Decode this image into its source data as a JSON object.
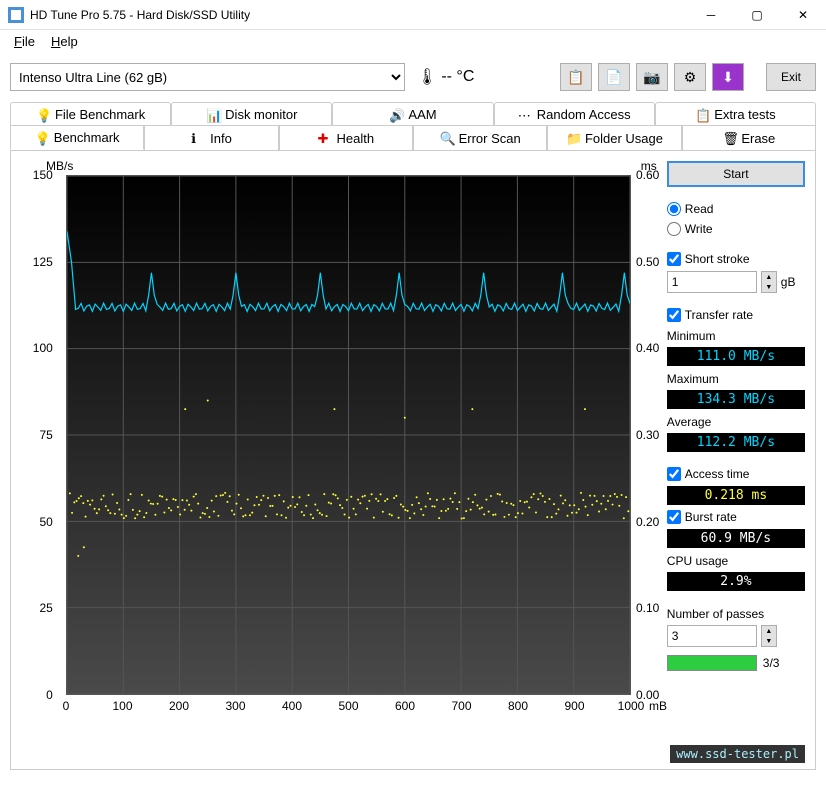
{
  "window": {
    "title": "HD Tune Pro 5.75 - Hard Disk/SSD Utility"
  },
  "menu": {
    "file": "File",
    "help": "Help"
  },
  "toolbar": {
    "drive": "Intenso Ultra Line (62 gB)",
    "temp": "-- °C",
    "exit": "Exit"
  },
  "tabs": {
    "top": [
      "File Benchmark",
      "Disk monitor",
      "AAM",
      "Random Access",
      "Extra tests"
    ],
    "bottom": [
      "Benchmark",
      "Info",
      "Health",
      "Error Scan",
      "Folder Usage",
      "Erase"
    ],
    "active": "Benchmark"
  },
  "side": {
    "start": "Start",
    "read": "Read",
    "write": "Write",
    "short_stroke": "Short stroke",
    "short_stroke_val": "1",
    "short_stroke_unit": "gB",
    "transfer_rate": "Transfer rate",
    "minimum": "Minimum",
    "minimum_val": "111.0 MB/s",
    "maximum": "Maximum",
    "maximum_val": "134.3 MB/s",
    "average": "Average",
    "average_val": "112.2 MB/s",
    "access_time": "Access time",
    "access_time_val": "0.218 ms",
    "burst_rate": "Burst rate",
    "burst_rate_val": "60.9 MB/s",
    "cpu_usage": "CPU usage",
    "cpu_usage_val": "2.9%",
    "passes": "Number of passes",
    "passes_val": "3",
    "passes_done": "3/3"
  },
  "chart_data": {
    "type": "line",
    "y_left_label": "MB/s",
    "y_right_label": "ms",
    "x_label": "mB",
    "y_left_ticks": [
      0,
      25,
      50,
      75,
      100,
      125,
      150
    ],
    "y_right_ticks": [
      0,
      0.1,
      0.2,
      0.3,
      0.4,
      0.5,
      0.6
    ],
    "x_ticks": [
      0,
      100,
      200,
      300,
      400,
      500,
      600,
      700,
      800,
      900,
      1000
    ],
    "xlim": [
      0,
      1000
    ],
    "ylim_left": [
      0,
      150
    ],
    "ylim_right": [
      0,
      0.6
    ],
    "series": [
      {
        "name": "transfer_rate_MBs",
        "axis": "left",
        "color": "#00d6ff",
        "baseline": 112,
        "spikes_at_x": [
          0,
          150,
          300,
          450,
          590,
          740,
          880,
          990
        ],
        "spike_peak": 122,
        "initial_peak": 134
      },
      {
        "name": "access_time_ms",
        "axis": "right",
        "color": "#ffff32",
        "mean": 0.218,
        "spread": 0.015,
        "outliers_low": [
          {
            "x": 20,
            "y": 0.16
          },
          {
            "x": 30,
            "y": 0.17
          }
        ],
        "outliers_high": [
          {
            "x": 210,
            "y": 0.33
          },
          {
            "x": 250,
            "y": 0.34
          },
          {
            "x": 475,
            "y": 0.33
          },
          {
            "x": 600,
            "y": 0.32
          },
          {
            "x": 720,
            "y": 0.33
          },
          {
            "x": 920,
            "y": 0.33
          }
        ]
      }
    ]
  },
  "watermark": "www.ssd-tester.pl"
}
